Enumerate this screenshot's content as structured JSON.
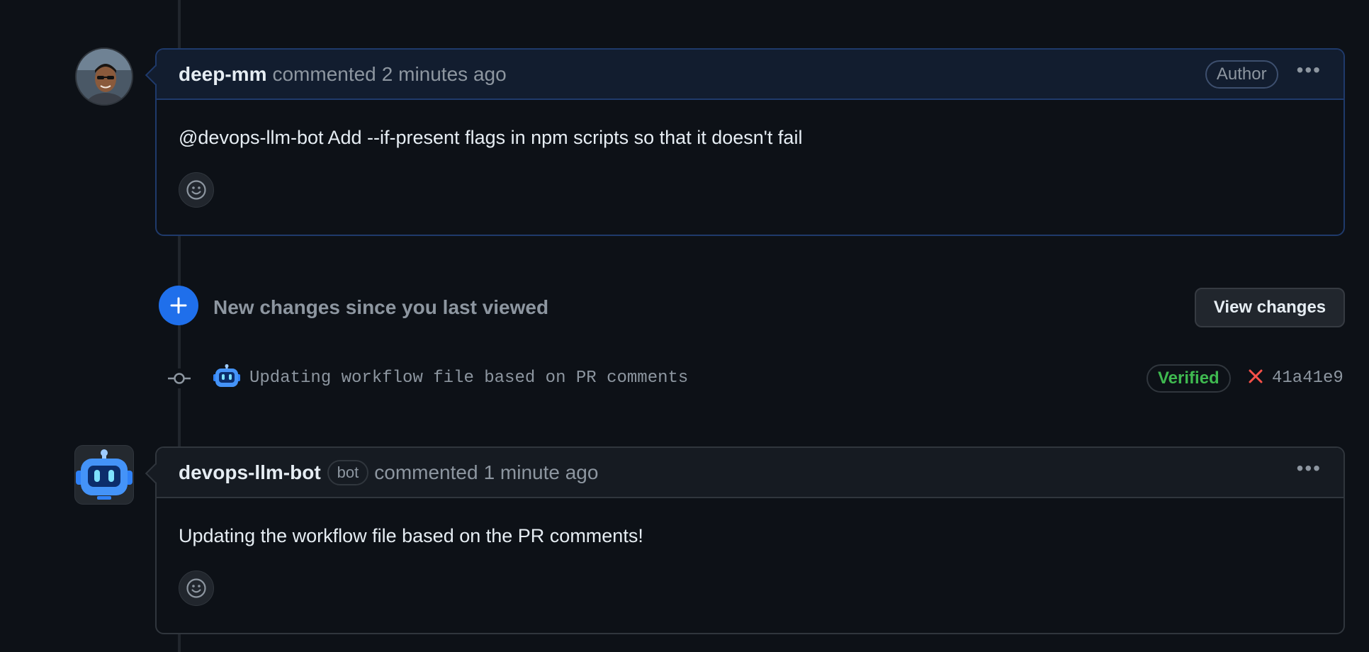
{
  "comments": [
    {
      "author": "deep-mm",
      "action": "commented",
      "time": "2 minutes ago",
      "label": "Author",
      "body": "@devops-llm-bot Add --if-present flags in npm scripts so that it doesn't fail",
      "menu_icon": "kebab-horizontal-icon",
      "reaction_icon": "smiley-icon"
    },
    {
      "author": "devops-llm-bot",
      "bot_label": "bot",
      "action": "commented",
      "time": "1 minute ago",
      "body": "Updating the workflow file based on the PR comments!",
      "menu_icon": "kebab-horizontal-icon",
      "reaction_icon": "smiley-icon"
    }
  ],
  "new_changes": {
    "text": "New changes since you last viewed",
    "button_label": "View changes",
    "icon": "plus-icon",
    "icon_color": "#1f6feb"
  },
  "commit": {
    "message": "Updating workflow file based on PR comments",
    "verified_label": "Verified",
    "status_icon": "x-icon",
    "status_color": "#f85149",
    "sha": "41a41e9",
    "author_icon": "robot-icon"
  },
  "colors": {
    "background": "#0d1117",
    "accent_blue": "#1f6feb",
    "verified_green": "#3fb950",
    "muted_text": "#8d96a0"
  }
}
